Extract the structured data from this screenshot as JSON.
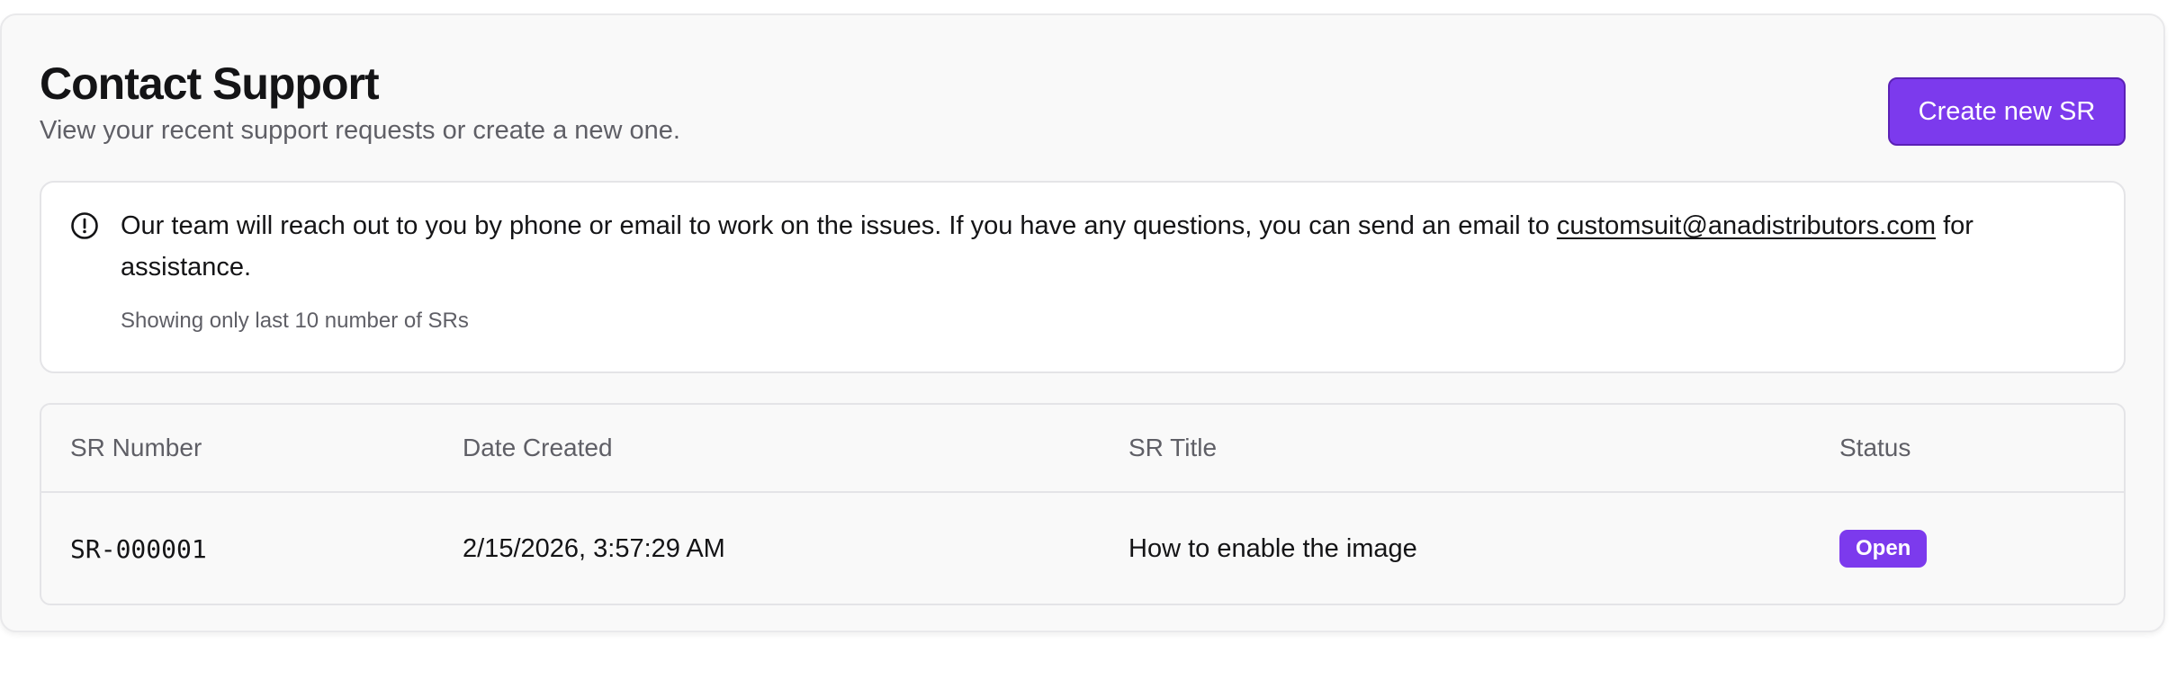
{
  "header": {
    "title": "Contact Support",
    "subtitle": "View your recent support requests or create a new one.",
    "create_button_label": "Create new SR"
  },
  "notice": {
    "icon": "alert-circle-icon",
    "text_before": "Our team will reach out to you by phone or email to work on the issues. If you have any questions, you can send an email to",
    "email": "customsuit@anadistributors.com",
    "text_after": "for assistance.",
    "caption": "Showing only last 10 number of SRs"
  },
  "table": {
    "columns": [
      "SR Number",
      "Date Created",
      "SR Title",
      "Status"
    ],
    "rows": [
      {
        "sr_number": "SR-000001",
        "date_created": "2/15/2026, 3:57:29 AM",
        "title": "How to enable the image",
        "status": "Open"
      }
    ]
  },
  "colors": {
    "accent": "#7c3aed",
    "accent_border": "#5b21b6",
    "card_background": "#f9f9f9",
    "border": "#e4e4e7",
    "muted_text": "#5f5f66"
  }
}
